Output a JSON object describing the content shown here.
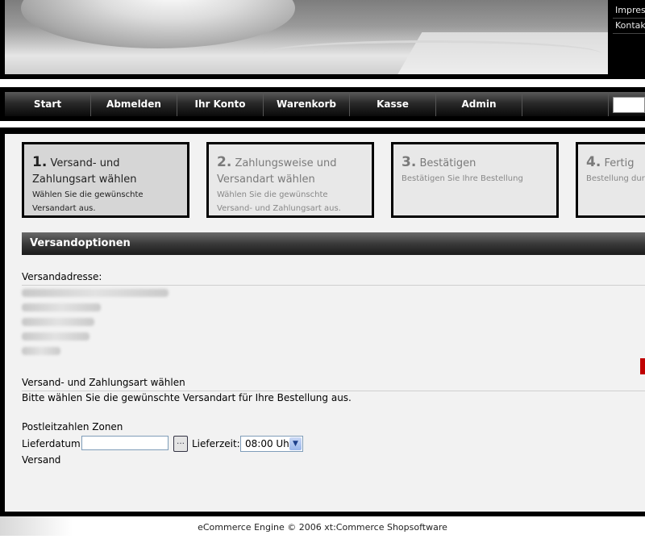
{
  "header": {
    "top_links": [
      "Impres",
      "Kontak"
    ]
  },
  "nav": {
    "items": [
      "Start",
      "Abmelden",
      "Ihr Konto",
      "Warenkorb",
      "Kasse",
      "Admin",
      ""
    ]
  },
  "steps": [
    {
      "number": "1.",
      "title": "Versand- und Zahlungsart wählen",
      "desc": "Wählen Sie die gewünschte Versandart aus.",
      "active": true
    },
    {
      "number": "2.",
      "title": "Zahlungsweise und Versandart wählen",
      "desc": "Wählen Sie die gewünschte Versand- und Zahlungsart aus.",
      "active": false
    },
    {
      "number": "3.",
      "title": "Bestätigen",
      "desc": "Bestätigen Sie Ihre Bestellung",
      "active": false
    },
    {
      "number": "4.",
      "title": "Fertig",
      "desc": "Bestellung durc",
      "active": false
    }
  ],
  "section": {
    "title": "Versandoptionen"
  },
  "address": {
    "label": "Versandadresse:"
  },
  "shipping": {
    "heading": "Versand- und Zahlungsart wählen",
    "hint": "Bitte wählen Sie die gewünschte Versandart für Ihre Bestellung aus.",
    "zones_label": "Postleitzahlen Zonen",
    "date_label": "Lieferdatum:",
    "date_value": "",
    "time_label": "Lieferzeit:",
    "time_value": "08:00 Uh",
    "versand_label": "Versand"
  },
  "footer": {
    "prefix": "eCommerce Engine © 2006 ",
    "brand": "xt:Commerce Shopsoftware"
  },
  "icons": {
    "calendar": "calendar-icon",
    "dropdown": "chevron-down-icon"
  },
  "colors": {
    "accent_red": "#c00000"
  }
}
